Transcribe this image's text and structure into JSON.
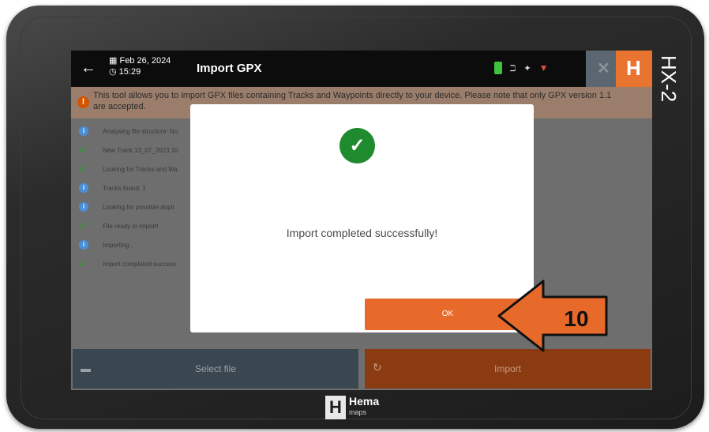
{
  "device": {
    "model_label": "HX-2",
    "brand": "Hema",
    "brand_sub": "maps"
  },
  "topbar": {
    "date": "Feb 26, 2024",
    "time": "15:29",
    "title": "Import GPX",
    "back_icon": "arrow-left-icon"
  },
  "info": {
    "text": "This tool allows you to import GPX files containing Tracks and Waypoints directly to your device. Please note that only GPX version 1.1 are accepted."
  },
  "log": [
    {
      "type": "info",
      "text": "Analysing file structure: No"
    },
    {
      "type": "ok",
      "text": "New Track 13_07_2023 10"
    },
    {
      "type": "ok",
      "text": "Looking for Tracks and Wa"
    },
    {
      "type": "info",
      "text": "Tracks found: 1"
    },
    {
      "type": "info",
      "text": "Looking for possible dupli"
    },
    {
      "type": "ok",
      "text": "File ready to import!"
    },
    {
      "type": "info",
      "text": "Importing..."
    },
    {
      "type": "ok",
      "text": "Import completed success"
    }
  ],
  "buttons": {
    "select_file": "Select file",
    "import": "Import"
  },
  "dialog": {
    "message": "Import completed successfully!",
    "ok_label": "OK"
  },
  "annotation": {
    "step_number": "10"
  },
  "colors": {
    "accent": "#e86a2a",
    "success": "#1f8a2e",
    "info": "#4a90d9"
  }
}
